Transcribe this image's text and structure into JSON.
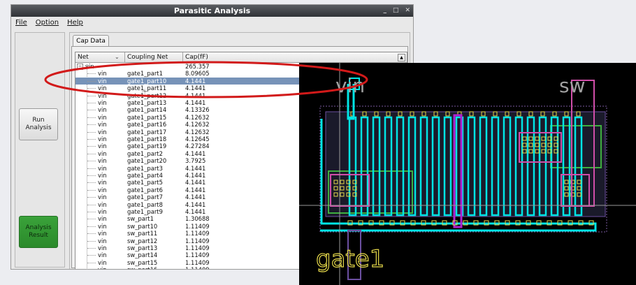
{
  "window": {
    "title": "Parasitic Analysis",
    "controls": [
      "_",
      "□",
      "✕"
    ]
  },
  "menu": [
    "File",
    "Option",
    "Help"
  ],
  "buttons": {
    "run": "Run\nAnalysis",
    "result": "Analysis\nResult"
  },
  "tab": {
    "label": "Cap Data"
  },
  "table": {
    "columns": [
      "Net",
      "Coupling Net",
      "Cap(fF)"
    ],
    "root": {
      "net": "vin",
      "cap": "265.357"
    },
    "rows": [
      {
        "net": "vin",
        "coupling": "gate1_part1",
        "cap": "8.09605"
      },
      {
        "net": "vin",
        "coupling": "gate1_part10",
        "cap": "4.1441",
        "selected": true
      },
      {
        "net": "vin",
        "coupling": "gate1_part11",
        "cap": "4.1441"
      },
      {
        "net": "vin",
        "coupling": "gate1_part12",
        "cap": "4.1441"
      },
      {
        "net": "vin",
        "coupling": "gate1_part13",
        "cap": "4.1441"
      },
      {
        "net": "vin",
        "coupling": "gate1_part14",
        "cap": "4.13326"
      },
      {
        "net": "vin",
        "coupling": "gate1_part15",
        "cap": "4.12632"
      },
      {
        "net": "vin",
        "coupling": "gate1_part16",
        "cap": "4.12632"
      },
      {
        "net": "vin",
        "coupling": "gate1_part17",
        "cap": "4.12632"
      },
      {
        "net": "vin",
        "coupling": "gate1_part18",
        "cap": "4.12645"
      },
      {
        "net": "vin",
        "coupling": "gate1_part19",
        "cap": "4.27284"
      },
      {
        "net": "vin",
        "coupling": "gate1_part2",
        "cap": "4.1441"
      },
      {
        "net": "vin",
        "coupling": "gate1_part20",
        "cap": "3.7925"
      },
      {
        "net": "vin",
        "coupling": "gate1_part3",
        "cap": "4.1441"
      },
      {
        "net": "vin",
        "coupling": "gate1_part4",
        "cap": "4.1441"
      },
      {
        "net": "vin",
        "coupling": "gate1_part5",
        "cap": "4.1441"
      },
      {
        "net": "vin",
        "coupling": "gate1_part6",
        "cap": "4.1441"
      },
      {
        "net": "vin",
        "coupling": "gate1_part7",
        "cap": "4.1441"
      },
      {
        "net": "vin",
        "coupling": "gate1_part8",
        "cap": "4.1441"
      },
      {
        "net": "vin",
        "coupling": "gate1_part9",
        "cap": "4.1441"
      },
      {
        "net": "vin",
        "coupling": "sw_part1",
        "cap": "1.30688"
      },
      {
        "net": "vin",
        "coupling": "sw_part10",
        "cap": "1.11409"
      },
      {
        "net": "vin",
        "coupling": "sw_part11",
        "cap": "1.11409"
      },
      {
        "net": "vin",
        "coupling": "sw_part12",
        "cap": "1.11409"
      },
      {
        "net": "vin",
        "coupling": "sw_part13",
        "cap": "1.11409"
      },
      {
        "net": "vin",
        "coupling": "sw_part14",
        "cap": "1.11409"
      },
      {
        "net": "vin",
        "coupling": "sw_part15",
        "cap": "1.11409"
      },
      {
        "net": "vin",
        "coupling": "sw_part16",
        "cap": "1.11409"
      }
    ]
  },
  "layout_view": {
    "labels": {
      "vin": "vin",
      "sw": "sw",
      "gate": "gate1"
    },
    "colors": {
      "cyan": "#00e5e5",
      "magenta": "#b020d0",
      "yellow": "#e6d94a",
      "pink": "#d04ea8",
      "green": "#3fae3f"
    }
  },
  "annotation_color": "#d21a1a"
}
